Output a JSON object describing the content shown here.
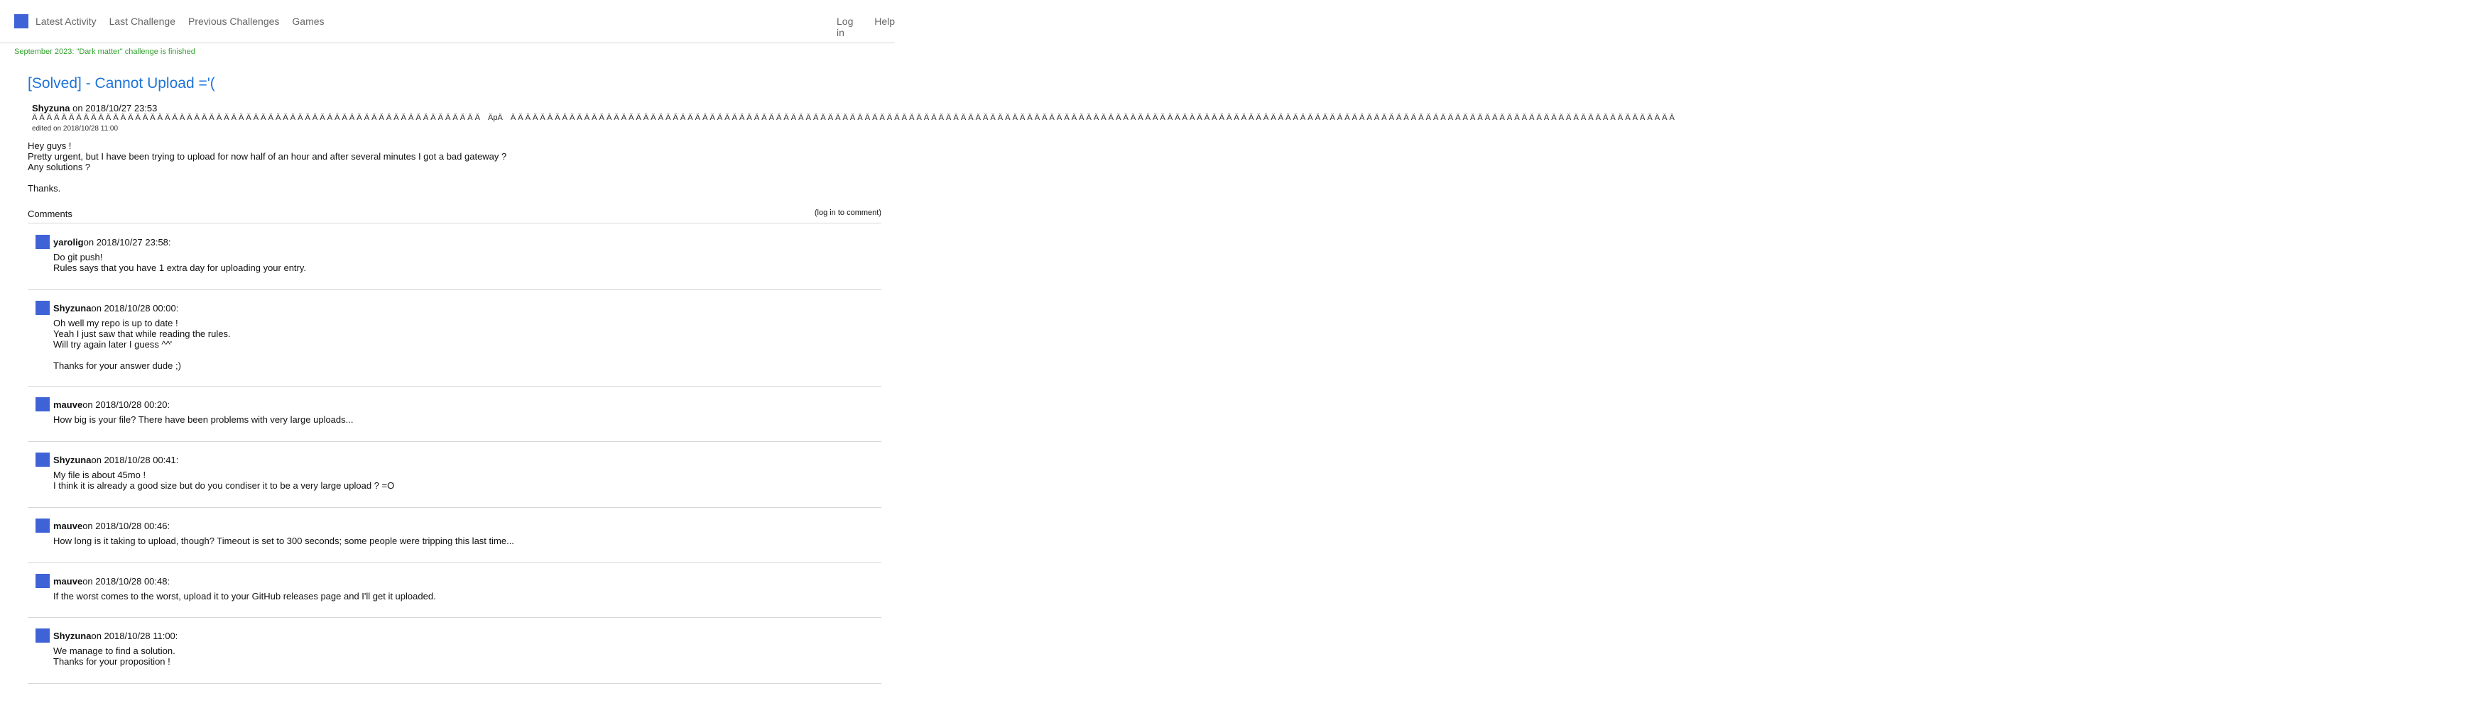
{
  "nav": {
    "items": [
      "Latest Activity",
      "Last Challenge",
      "Previous Challenges",
      "Games"
    ],
    "login": "Log in",
    "help": "Help"
  },
  "banner": "September 2023: \"Dark matter\" challenge is finished",
  "post": {
    "title": "[Solved] - Cannot Upload ='(",
    "author": "Shyzuna",
    "date": "on 2018/10/27 23:53",
    "reactions_pre": "Â  Â  Â  Â  Â  Â  Â  Â  Â  Â  Â  Â  Â  Â  Â  Â  Â  Â  Â  Â  Â  Â  Â  Â  Â  Â  Â  Â  Â  Â  Â  Â  Â  Â  Â  Â  Â  Â  Â  Â  Â  Â  Â  Â  Â  Â  Â  Â  Â  Â  Â  Â  Â  Â  Â  Â  Â  Â  Â  Â  Â",
    "reactions_mid": "ÂpÂ",
    "reactions_post": "Â  Â  Â  Â  Â  Â  Â  Â  Â  Â  Â  Â  Â  Â  Â  Â  Â  Â  Â  Â  Â  Â  Â  Â  Â  Â  Â  Â  Â  Â  Â  Â  Â  Â  Â  Â  Â  Â  Â  Â  Â  Â  Â  Â  Â  Â  Â  Â  Â  Â  Â  Â  Â  Â  Â  Â  Â  Â  Â  Â  Â  Â  Â  Â  Â  Â  Â  Â  Â  Â  Â  Â  Â  Â  Â  Â  Â  Â  Â  Â  Â  Â  Â  Â  Â  Â  Â  Â  Â  Â  Â  Â  Â  Â  Â  Â  Â  Â  Â  Â  Â  Â  Â  Â  Â  Â  Â  Â  Â  Â  Â  Â  Â  Â  Â  Â  Â  Â  Â  Â  Â  Â  Â  Â  Â  Â  Â  Â  Â  Â  Â  Â  Â  Â  Â  Â  Â  Â  Â  Â  Â  Â  Â  Â  Â  Â  Â  Â  Â  Â  Â  Â  Â  Â  Â  Â  Â  Â",
    "edited": "edited on 2018/10/28 11:00",
    "body": [
      "Hey guys !",
      "Pretty urgent, but I have been trying to upload for now half of an hour and after several minutes I got a bad gateway ?",
      "Any solutions ?",
      "",
      "Thanks."
    ]
  },
  "comments_section": {
    "title": "Comments",
    "login_link": "(log in to comment)"
  },
  "comments": [
    {
      "author": "yarolig",
      "date": "on 2018/10/27 23:58:",
      "lines": [
        "Do git push!",
        "Rules says that you have 1 extra day for uploading your entry."
      ]
    },
    {
      "author": "Shyzuna",
      "date": "on 2018/10/28 00:00:",
      "lines": [
        "Oh well my repo is up to date !",
        "Yeah I just saw that while reading the rules.",
        "Will try again later I guess ^^'",
        "",
        "Thanks for your answer dude ;)"
      ]
    },
    {
      "author": "mauve",
      "date": "on 2018/10/28 00:20:",
      "lines": [
        "How big is your file? There have been problems with very large uploads..."
      ]
    },
    {
      "author": "Shyzuna",
      "date": "on 2018/10/28 00:41:",
      "lines": [
        "My file is about 45mo !",
        "I think it is already a good size but do you condiser it to be a very large upload ? =O"
      ]
    },
    {
      "author": "mauve",
      "date": "on 2018/10/28 00:46:",
      "lines": [
        "How long is it taking to upload, though? Timeout is set to 300 seconds; some people were tripping this last time..."
      ]
    },
    {
      "author": "mauve",
      "date": "on 2018/10/28 00:48:",
      "lines": [
        "If the worst comes to the worst, upload it to your GitHub releases page and I'll get it uploaded."
      ]
    },
    {
      "author": "Shyzuna",
      "date": "on 2018/10/28 11:00:",
      "lines": [
        "We manage to find a solution.",
        "Thanks for your proposition !"
      ]
    }
  ],
  "colors": {
    "accent": "#3f63d6",
    "title": "#1e73d8",
    "banner": "#33a12f",
    "nav": "#666666",
    "divider": "#d6d6d6"
  },
  "icons": {
    "logo": "site-logo-square",
    "avatar": "user-avatar-square"
  }
}
